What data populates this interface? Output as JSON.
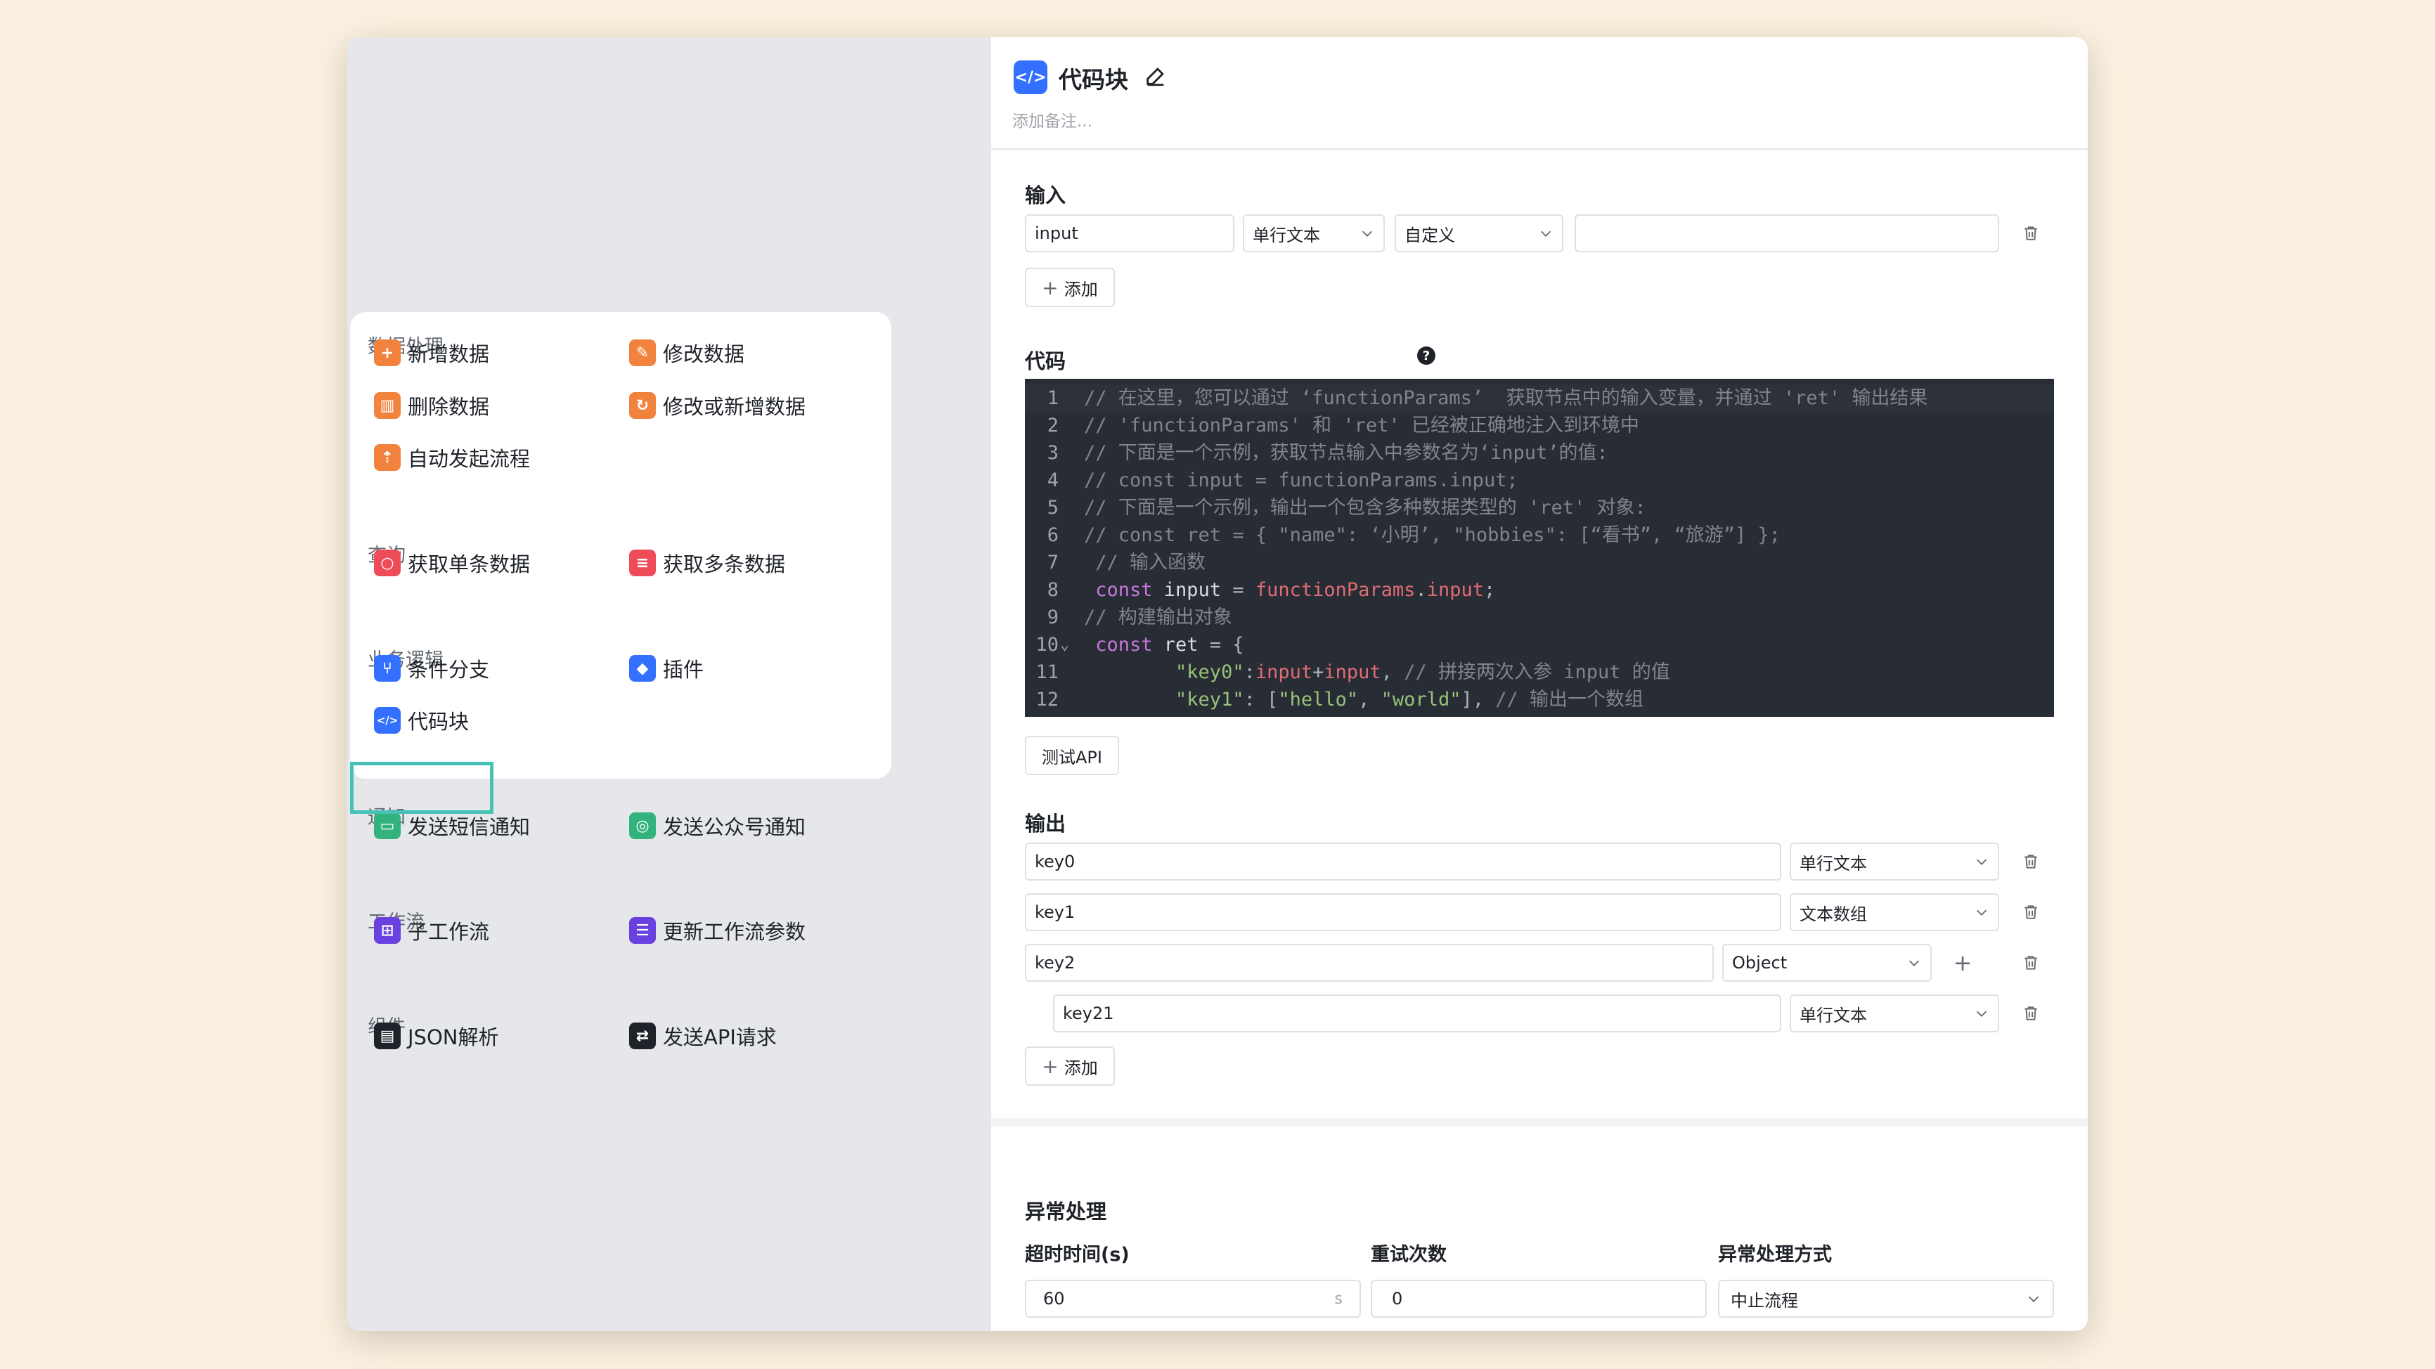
{
  "menu": {
    "categories": [
      "数据处理",
      "查询",
      "业务逻辑",
      "通知",
      "工作流",
      "组件"
    ],
    "items": [
      {
        "label": "新增数据",
        "icon": "file-add-icon",
        "color": "#f2833e"
      },
      {
        "label": "修改数据",
        "icon": "file-edit-icon",
        "color": "#f2833e"
      },
      {
        "label": "删除数据",
        "icon": "trash-icon",
        "color": "#f2833e"
      },
      {
        "label": "修改或新增数据",
        "icon": "file-sync-icon",
        "color": "#f2833e"
      },
      {
        "label": "自动发起流程",
        "icon": "launch-icon",
        "color": "#f2833e"
      },
      {
        "label": "获取单条数据",
        "icon": "search-icon",
        "color": "#ef4c5a"
      },
      {
        "label": "获取多条数据",
        "icon": "stack-search-icon",
        "color": "#ef4c5a"
      },
      {
        "label": "条件分支",
        "icon": "branch-icon",
        "color": "#3370ff"
      },
      {
        "label": "插件",
        "icon": "cube-icon",
        "color": "#3370ff"
      },
      {
        "label": "代码块",
        "icon": "code-icon",
        "color": "#3370ff"
      },
      {
        "label": "发送短信通知",
        "icon": "sms-icon",
        "color": "#34b27d"
      },
      {
        "label": "发送公众号通知",
        "icon": "wechat-icon",
        "color": "#34b27d"
      },
      {
        "label": "子工作流",
        "icon": "subflow-icon",
        "color": "#6941e0"
      },
      {
        "label": "更新工作流参数",
        "icon": "sliders-icon",
        "color": "#6941e0"
      },
      {
        "label": "JSON解析",
        "icon": "json-icon",
        "color": "#1f2329"
      },
      {
        "label": "发送API请求",
        "icon": "api-icon",
        "color": "#1f2329"
      }
    ]
  },
  "panel": {
    "title": "代码块",
    "note_placeholder": "添加备注...",
    "input": {
      "label": "输入",
      "name": "input",
      "type": "单行文本",
      "source": "自定义",
      "value": "",
      "add_label": "添加"
    },
    "code": {
      "label": "代码",
      "lines": [
        [
          {
            "c": "cm",
            "t": "// 在这里，您可以通过 ‘functionParams’  获取节点中的输入变量，并通过 'ret' 输出结果"
          }
        ],
        [
          {
            "c": "cm",
            "t": "// 'functionParams' 和 'ret' 已经被正确地注入到环境中"
          }
        ],
        [
          {
            "c": "cm",
            "t": "// 下面是一个示例，获取节点输入中参数名为‘input’的值:"
          }
        ],
        [
          {
            "c": "cm",
            "t": "// const input = functionParams.input;"
          }
        ],
        [
          {
            "c": "cm",
            "t": "// 下面是一个示例，输出一个包含多种数据类型的 'ret' 对象:"
          }
        ],
        [
          {
            "c": "cm",
            "t": "// const ret = { \"name\": ‘小明’, \"hobbies\": [“看书”, “旅游”] };"
          }
        ],
        [
          {
            "c": "cm",
            "t": " // 输入函数"
          }
        ],
        [
          {
            "c": "kw",
            "t": " const "
          },
          {
            "c": "wh",
            "t": "input "
          },
          {
            "c": "pl",
            "t": "= "
          },
          {
            "c": "vr",
            "t": "functionParams"
          },
          {
            "c": "pl",
            "t": "."
          },
          {
            "c": "vr",
            "t": "input"
          },
          {
            "c": "pl",
            "t": ";"
          }
        ],
        [
          {
            "c": "cm",
            "t": "// 构建输出对象"
          }
        ],
        [
          {
            "c": "kw",
            "t": " const "
          },
          {
            "c": "wh",
            "t": "ret "
          },
          {
            "c": "pl",
            "t": "= {"
          }
        ],
        [
          {
            "c": "st",
            "t": "        \"key0\""
          },
          {
            "c": "pl",
            "t": ":"
          },
          {
            "c": "vr",
            "t": "input"
          },
          {
            "c": "pl",
            "t": "+"
          },
          {
            "c": "vr",
            "t": "input"
          },
          {
            "c": "pl",
            "t": ", "
          },
          {
            "c": "cm",
            "t": "// 拼接两次入参 input 的值"
          }
        ],
        [
          {
            "c": "st",
            "t": "        \"key1\""
          },
          {
            "c": "pl",
            "t": ": ["
          },
          {
            "c": "st",
            "t": "\"hello\""
          },
          {
            "c": "pl",
            "t": ", "
          },
          {
            "c": "st",
            "t": "\"world\""
          },
          {
            "c": "pl",
            "t": "], "
          },
          {
            "c": "cm",
            "t": "// 输出一个数组"
          }
        ]
      ],
      "line_numbers": [
        "1",
        "2",
        "3",
        "4",
        "5",
        "6",
        "7",
        "8",
        "9",
        "10",
        "11",
        "12"
      ],
      "test_label": "测试API"
    },
    "output": {
      "label": "输出",
      "rows": [
        {
          "name": "key0",
          "type": "单行文本"
        },
        {
          "name": "key1",
          "type": "文本数组"
        },
        {
          "name": "key2",
          "type": "Object"
        },
        {
          "name": "key21",
          "type": "单行文本"
        }
      ],
      "add_label": "添加"
    },
    "exception": {
      "label": "异常处理",
      "timeout_label": "超时时间(s)",
      "timeout_value": "60",
      "timeout_unit": "s",
      "retry_label": "重试次数",
      "retry_value": "0",
      "mode_label": "异常处理方式",
      "mode_value": "中止流程"
    }
  }
}
